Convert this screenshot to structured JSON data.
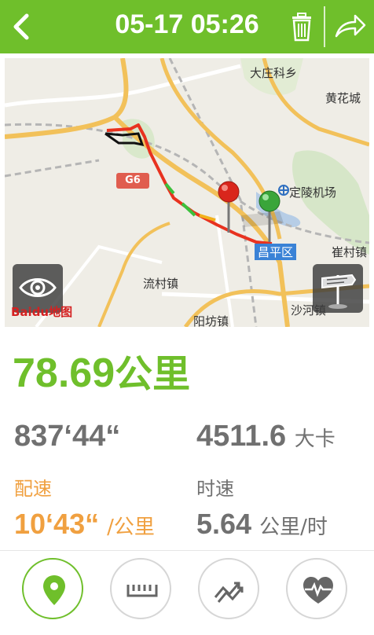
{
  "header": {
    "title": "05-17 05:26",
    "back_icon": "back-chevron-icon",
    "trash_icon": "trash-icon",
    "share_icon": "share-arrow-icon",
    "background_color": "#6fbf2b"
  },
  "map": {
    "labels": {
      "dazhuangke": "大庄科乡",
      "huanghuacheng": "黄花城",
      "dingling": "定陵机场",
      "changping": "昌平区",
      "cuicun": "崔村镇",
      "liucun": "流村镇",
      "shahe": "沙河镇",
      "yangfang": "阳坊镇"
    },
    "highway_shield": "G6",
    "logo": "Baidu地图",
    "view_toggle_icon": "eye-icon",
    "signpost_icon": "signpost-icon",
    "start_pin_color": "#d9261c",
    "end_pin_color": "#3aa53a"
  },
  "summary": {
    "distance_value": "78.69",
    "distance_unit": "公里",
    "duration": "837‘44“",
    "calories_value": "4511.6",
    "calories_unit": "大卡",
    "pace_label": "配速",
    "pace_value": "10‘43“",
    "pace_unit": "/公里",
    "speed_label": "时速",
    "speed_value": "5.64",
    "speed_unit": "公里/时",
    "accent_color": "#6fbf2b",
    "pace_color": "#f0a040"
  },
  "tabs": [
    {
      "name": "location-tab",
      "icon": "location-pin-icon",
      "active": true
    },
    {
      "name": "ruler-tab",
      "icon": "ruler-icon",
      "active": false
    },
    {
      "name": "trend-tab",
      "icon": "trend-arrows-icon",
      "active": false
    },
    {
      "name": "heart-tab",
      "icon": "heart-rate-icon",
      "active": false
    }
  ]
}
